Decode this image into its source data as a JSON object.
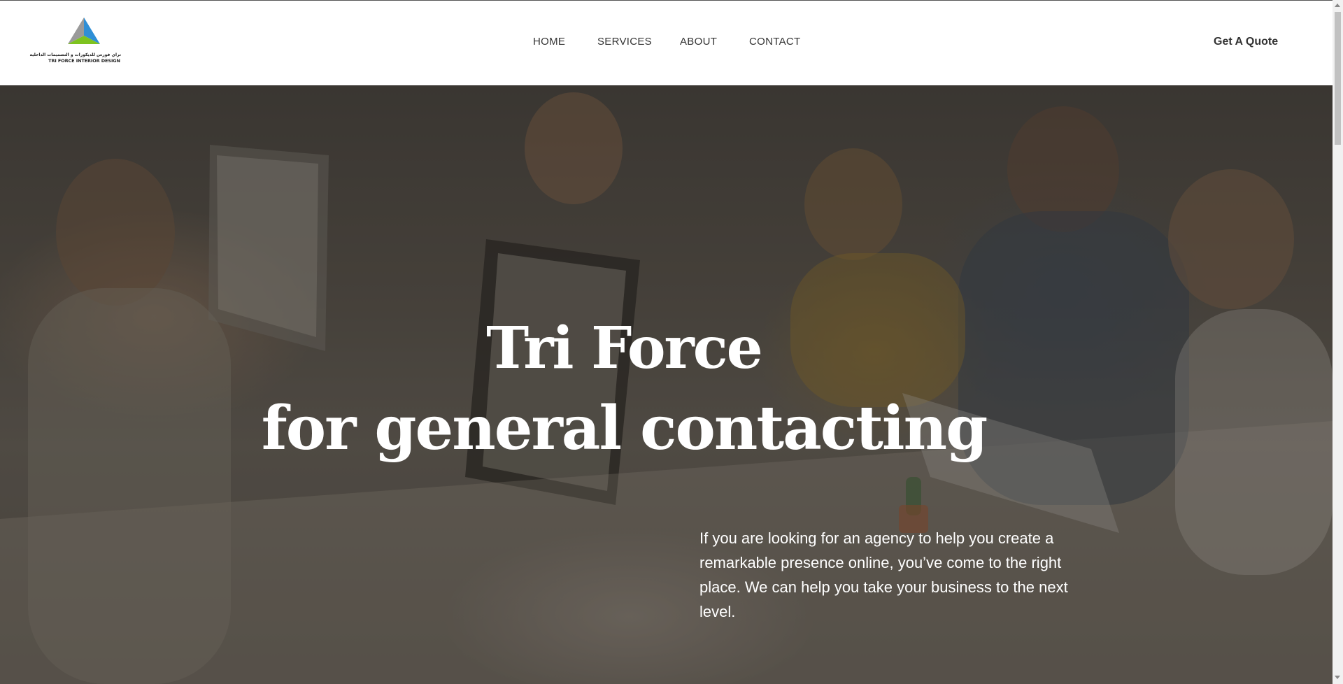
{
  "header": {
    "logo": {
      "arabic_text": "تراي فورس للديكورات و التصميمات الداخلية",
      "english_text": "TRI FORCE INTERIOR DESIGN",
      "colors": {
        "left": "#9a9a9a",
        "right": "#2f8fd6",
        "bottom": "#7ec31f"
      }
    },
    "nav": [
      {
        "label": "HOME"
      },
      {
        "label": "SERVICES"
      },
      {
        "label": "ABOUT"
      },
      {
        "label": "CONTACT"
      }
    ],
    "cta_label": "Get A Quote"
  },
  "hero": {
    "title_line1": "Tri Force",
    "title_line2": "for general contacting",
    "description": "If you are looking for an agency to help you create a remarkable presence online, you’ve come to the right place. We can help you take your business to the next level."
  }
}
